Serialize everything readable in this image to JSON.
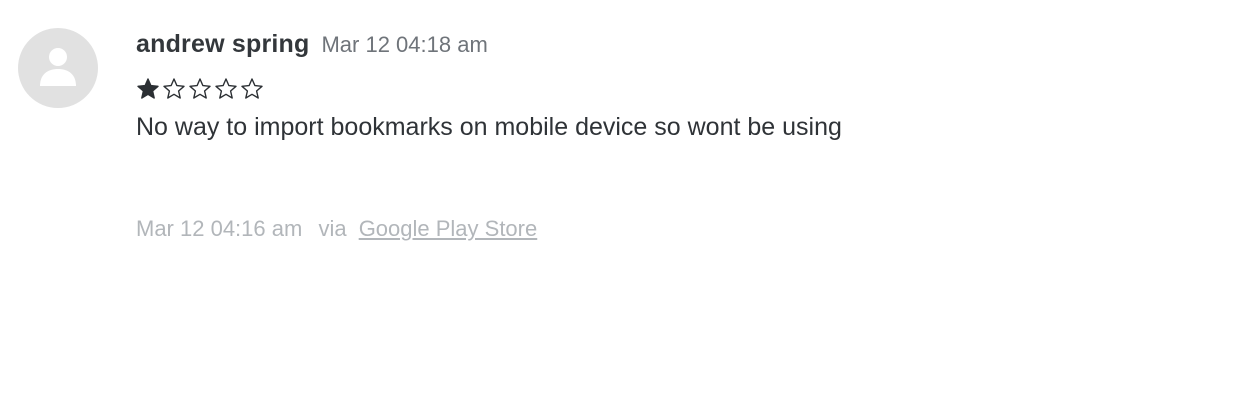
{
  "review": {
    "author": "andrew spring",
    "date": "Mar 12 04:18 am",
    "rating": 1,
    "rating_max": 5,
    "body": "No way to import bookmarks on mobile device so wont be using",
    "footer": {
      "timestamp": "Mar 12 04:16 am",
      "via_label": "via",
      "source_link": "Google Play Store"
    }
  },
  "colors": {
    "avatar_bg": "#e1e1e1",
    "avatar_fg": "#ffffff",
    "star": "#2b2f33",
    "muted_text": "#b2b6ba"
  },
  "icons": {
    "avatar": "user-silhouette-icon",
    "star_filled": "star-filled-icon",
    "star_empty": "star-outline-icon"
  }
}
